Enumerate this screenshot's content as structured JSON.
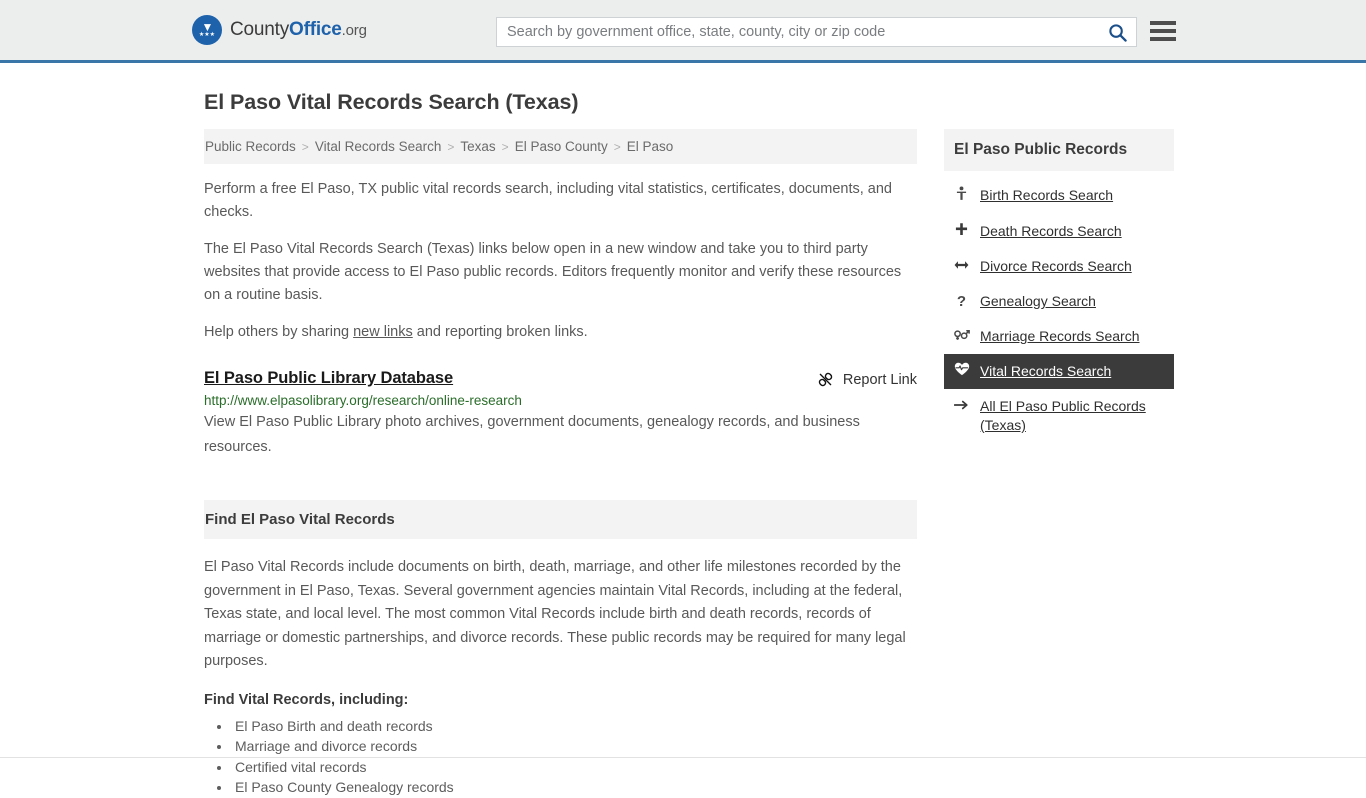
{
  "header": {
    "brand_prefix": "County",
    "brand_bold": "Office",
    "brand_tld": ".org",
    "brand_icon": "eagle-logo-icon",
    "search_placeholder": "Search by government office, state, county, city or zip code",
    "search_value": "",
    "search_icon": "search-icon",
    "menu_icon": "hamburger-menu-icon",
    "accent_color": "#3a76a8",
    "background_color": "#eceded"
  },
  "page": {
    "title": "El Paso Vital Records Search (Texas)"
  },
  "breadcrumb": {
    "separator": ">",
    "items": [
      {
        "label": "Public Records"
      },
      {
        "label": "Vital Records Search"
      },
      {
        "label": "Texas"
      },
      {
        "label": "El Paso County"
      },
      {
        "label": "El Paso"
      }
    ]
  },
  "intro": {
    "p1": "Perform a free El Paso, TX public vital records search, including vital statistics, certificates, documents, and checks.",
    "p2": "The El Paso Vital Records Search (Texas) links below open in a new window and take you to third party websites that provide access to El Paso public records. Editors frequently monitor and verify these resources on a routine basis.",
    "p3_before": "Help others by sharing ",
    "p3_link": "new links",
    "p3_after": " and reporting broken links."
  },
  "result": {
    "title": "El Paso Public Library Database",
    "url": "http://www.elpasolibrary.org/research/online-research",
    "description": "View El Paso Public Library photo archives, government documents, genealogy records, and business resources.",
    "report_label": "Report Link",
    "report_icon": "broken-link-icon",
    "url_color": "#2a6d2a"
  },
  "find_section": {
    "heading": "Find El Paso Vital Records",
    "body": "El Paso Vital Records include documents on birth, death, marriage, and other life milestones recorded by the government in El Paso, Texas. Several government agencies maintain Vital Records, including at the federal, Texas state, and local level. The most common Vital Records include birth and death records, records of marriage or domestic partnerships, and divorce records. These public records may be required for many legal purposes.",
    "sub_heading": "Find Vital Records, including:",
    "bullets": [
      "El Paso Birth and death records",
      "Marriage and divorce records",
      "Certified vital records",
      "El Paso County Genealogy records"
    ]
  },
  "sidebar": {
    "heading": "El Paso Public Records",
    "active_background": "#3b3b3b",
    "items": [
      {
        "label": "Birth Records Search",
        "icon": "baby-icon",
        "glyph": "♀",
        "active": false
      },
      {
        "label": "Death Records Search",
        "icon": "cross-icon",
        "glyph": "✚",
        "active": false
      },
      {
        "label": "Divorce Records Search",
        "icon": "left-right-arrow-icon",
        "glyph": "↔",
        "active": false
      },
      {
        "label": "Genealogy Search",
        "icon": "question-mark-icon",
        "glyph": "?",
        "active": false
      },
      {
        "label": "Marriage Records Search",
        "icon": "venus-mars-icon",
        "glyph": "⚥",
        "active": false
      },
      {
        "label": "Vital Records Search",
        "icon": "heartbeat-icon",
        "glyph": "♥",
        "active": true
      },
      {
        "label": "All El Paso Public Records (Texas)",
        "icon": "arrow-right-icon",
        "glyph": "→",
        "active": false
      }
    ]
  }
}
